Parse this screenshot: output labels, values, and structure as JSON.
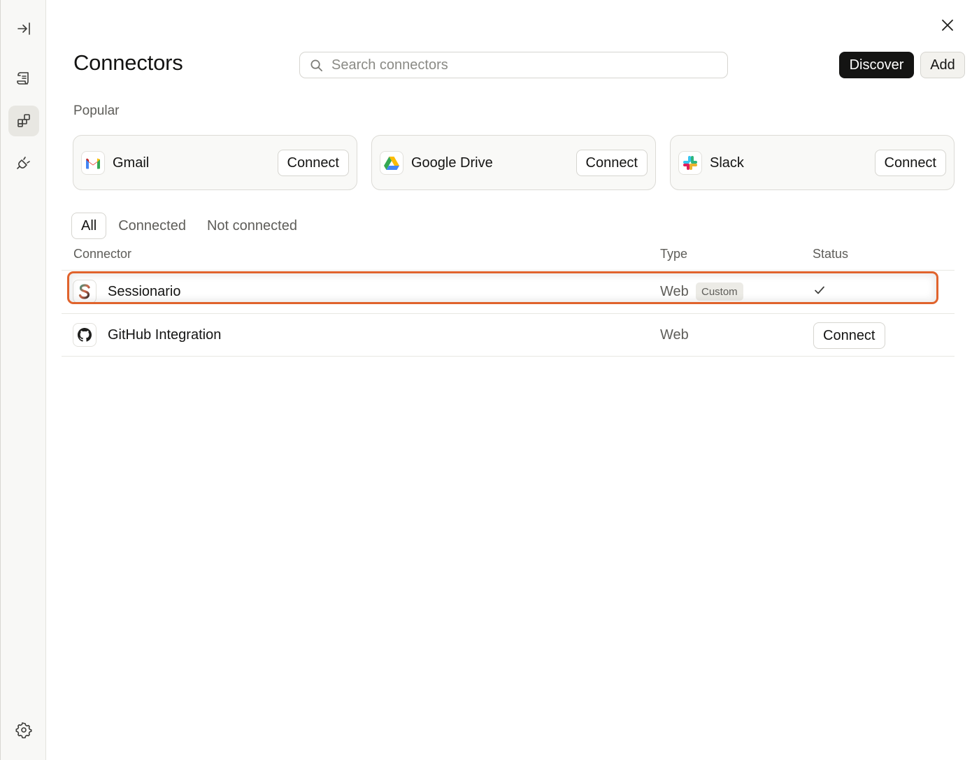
{
  "page": {
    "title": "Connectors",
    "search_placeholder": "Search connectors",
    "discover_label": "Discover",
    "add_label": "Add"
  },
  "popular": {
    "label": "Popular",
    "cards": [
      {
        "name": "Gmail",
        "connect_label": "Connect",
        "icon": "gmail-icon"
      },
      {
        "name": "Google Drive",
        "connect_label": "Connect",
        "icon": "google-drive-icon"
      },
      {
        "name": "Slack",
        "connect_label": "Connect",
        "icon": "slack-icon"
      }
    ]
  },
  "filters": {
    "tabs": [
      "All",
      "Connected",
      "Not connected"
    ],
    "active": "All"
  },
  "table": {
    "headers": {
      "connector": "Connector",
      "type": "Type",
      "status": "Status"
    },
    "rows": [
      {
        "name": "Sessionario",
        "type": "Web",
        "badge": "Custom",
        "status": "connected",
        "icon": "sessionario-icon"
      },
      {
        "name": "GitHub Integration",
        "type": "Web",
        "status_label": "Connect",
        "icon": "github-icon"
      }
    ]
  },
  "colors": {
    "highlight": "#e0632c",
    "primary_button": "#141413"
  }
}
